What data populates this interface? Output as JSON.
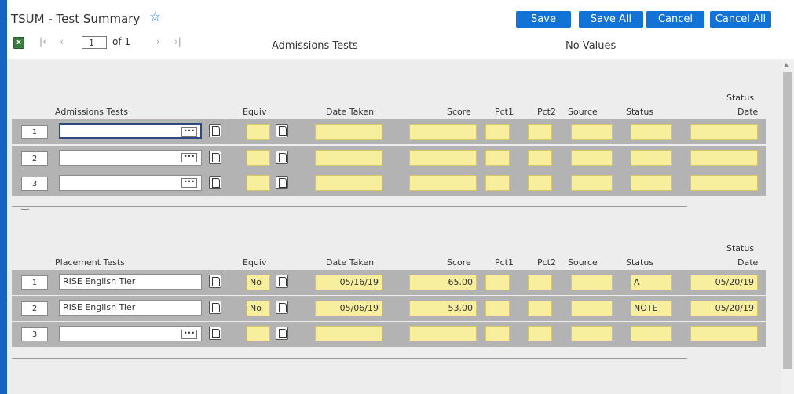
{
  "window": {
    "title": "TSUM - Test Summary"
  },
  "buttons": {
    "save": "Save",
    "save_all": "Save All",
    "cancel": "Cancel",
    "cancel_all": "Cancel All"
  },
  "toolbar": {
    "page_value": "1",
    "of_label": "of 1",
    "center_title": "Admissions Tests",
    "right_text": "No Values"
  },
  "colors": {
    "accent": "#1372d6",
    "border_blue": "#1565c0",
    "yellow_field": "#f7ee9e",
    "row_band": "#b3b3b3"
  },
  "icons": [
    "star-icon",
    "excel-icon",
    "first-page-icon",
    "prev-page-icon",
    "next-page-icon",
    "last-page-icon",
    "ellipsis-icon",
    "document-icon",
    "scroll-up-icon"
  ],
  "admissions": {
    "headers": {
      "name": "Admissions Tests",
      "equiv": "Equiv",
      "date_taken": "Date Taken",
      "score": "Score",
      "pct1": "Pct1",
      "pct2": "Pct2",
      "source": "Source",
      "status": "Status",
      "status_date_1": "Status",
      "status_date_2": "Date"
    },
    "rows": [
      {
        "num": "1",
        "test": "",
        "equiv": "",
        "date": "",
        "score": "",
        "pct1": "",
        "pct2": "",
        "source": "",
        "status": "",
        "status_date": ""
      },
      {
        "num": "2",
        "test": "",
        "equiv": "",
        "date": "",
        "score": "",
        "pct1": "",
        "pct2": "",
        "source": "",
        "status": "",
        "status_date": ""
      },
      {
        "num": "3",
        "test": "",
        "equiv": "",
        "date": "",
        "score": "",
        "pct1": "",
        "pct2": "",
        "source": "",
        "status": "",
        "status_date": ""
      }
    ]
  },
  "placement": {
    "headers": {
      "name": "Placement Tests",
      "equiv": "Equiv",
      "date_taken": "Date Taken",
      "score": "Score",
      "pct1": "Pct1",
      "pct2": "Pct2",
      "source": "Source",
      "status": "Status",
      "status_date_1": "Status",
      "status_date_2": "Date"
    },
    "rows": [
      {
        "num": "1",
        "test": "RISE English Tier",
        "equiv": "No",
        "date": "05/16/19",
        "score": "65.00",
        "pct1": "",
        "pct2": "",
        "source": "",
        "status": "A",
        "status_date": "05/20/19"
      },
      {
        "num": "2",
        "test": "RISE English Tier",
        "equiv": "No",
        "date": "05/06/19",
        "score": "53.00",
        "pct1": "",
        "pct2": "",
        "source": "",
        "status": "NOTE",
        "status_date": "05/20/19"
      },
      {
        "num": "3",
        "test": "",
        "equiv": "",
        "date": "",
        "score": "",
        "pct1": "",
        "pct2": "",
        "source": "",
        "status": "",
        "status_date": ""
      }
    ]
  }
}
